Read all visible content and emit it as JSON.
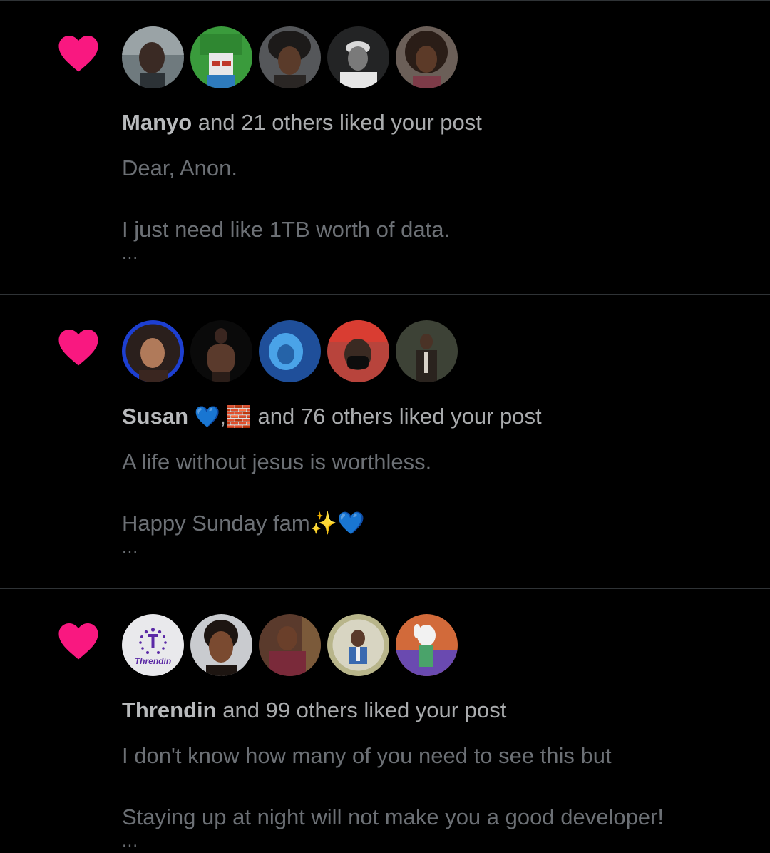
{
  "colors": {
    "background": "#000000",
    "divider": "#2f3336",
    "heart": "#f91880",
    "name_text": "#b8babc",
    "body_text": "#6c7075"
  },
  "notifications": [
    {
      "icon": "heart-icon",
      "name": "Manyo",
      "rest": " and 21 others liked your post",
      "post_line1": "Dear, Anon.",
      "post_line2": "I just need like 1TB worth of data.",
      "ellipsis": "..."
    },
    {
      "icon": "heart-icon",
      "name": "Susan",
      "name_emoji": "💙,",
      "name2_emoji": "🧱",
      "rest": " and 76 others liked your post",
      "post_line1": "A life without jesus is worthless.",
      "post_line2": "Happy Sunday fam✨💙",
      "ellipsis": "..."
    },
    {
      "icon": "heart-icon",
      "name": "Threndin",
      "rest": " and 99 others liked your post",
      "post_line1": "I don't know how many of you need to see this but",
      "post_line2": "Staying up at night will not make you a good developer!",
      "ellipsis": "..."
    }
  ],
  "threndin_logo_text": "Threndin"
}
